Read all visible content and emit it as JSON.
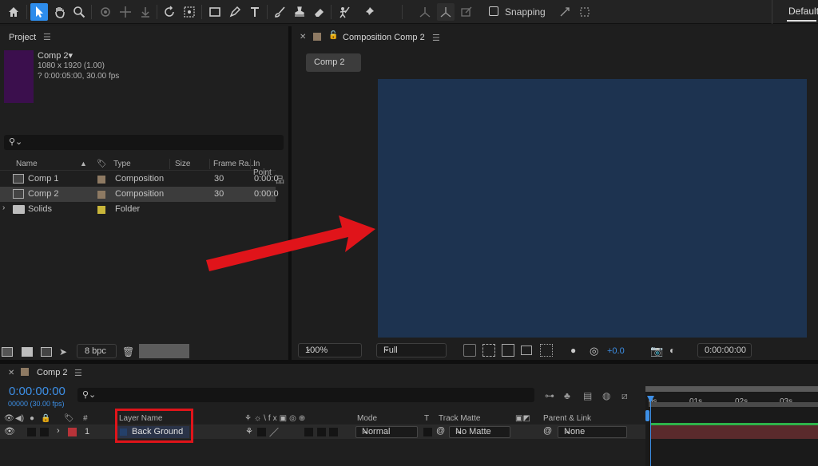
{
  "toolbar": {
    "snapping_label": "Snapping",
    "workspace_label": "Default",
    "icons": [
      "home-icon",
      "selection-arrow-icon",
      "hand-icon",
      "zoom-icon",
      "orbit-camera-icon",
      "pan-camera-icon",
      "dolly-camera-icon",
      "rotation-icon",
      "anchor-point-icon",
      "rectangle-icon",
      "pen-icon",
      "type-icon",
      "brush-icon",
      "clone-stamp-icon",
      "eraser-icon",
      "roto-brush-icon",
      "puppet-pin-icon",
      "local-axis-icon",
      "world-axis-icon",
      "view-axis-icon",
      "snapping-checkbox",
      "snap-icon",
      "snap-grid-icon"
    ]
  },
  "project": {
    "panel_title": "Project",
    "comp_name": "Comp 2",
    "comp_resolution": "1080 x 1920 (1.00)",
    "comp_duration": "? 0:00:05:00, 30.00 fps",
    "thumbnail_color": "#3b0f4d",
    "columns": [
      "Name",
      "Type",
      "Size",
      "Frame Ra...",
      "In Point"
    ],
    "items": [
      {
        "name": "Comp 1",
        "type": "Composition",
        "frame_rate": "30",
        "in_point": "0:00:0",
        "label_color": "#8e7a63",
        "kind": "composition"
      },
      {
        "name": "Comp 2",
        "type": "Composition",
        "frame_rate": "30",
        "in_point": "0:00:0",
        "label_color": "#8e7a63",
        "kind": "composition",
        "selected": true
      },
      {
        "name": "Solids",
        "type": "Folder",
        "frame_rate": "",
        "in_point": "",
        "label_color": "#c9b63a",
        "kind": "folder"
      }
    ],
    "bit_depth": "8 bpc"
  },
  "composition": {
    "tab_label": "Composition Comp 2",
    "chip_label": "Comp 2",
    "canvas_color": "#1d3350",
    "zoom": "100%",
    "resolution": "Full",
    "exposure": "+0.0",
    "current_time": "0:00:00:00"
  },
  "timeline": {
    "tab_label": "Comp 2",
    "timecode": "0:00:00:00",
    "fps_label": "00000 (30.00 fps)",
    "columns": {
      "number": "#",
      "layer_name": "Layer Name",
      "mode": "Mode",
      "t": "T",
      "track_matte": "Track Matte",
      "parent_link": "Parent & Link"
    },
    "layer": {
      "index": "1",
      "name": "Back Ground",
      "mode": "Normal",
      "track_matte": "No Matte",
      "parent": "None",
      "label_color": "#b73339"
    },
    "ruler_ticks": [
      "0s",
      "01s",
      "02s",
      "03s"
    ]
  },
  "annotation": {
    "arrow_color": "#e0141a",
    "highlight_color": "#e0141a"
  }
}
